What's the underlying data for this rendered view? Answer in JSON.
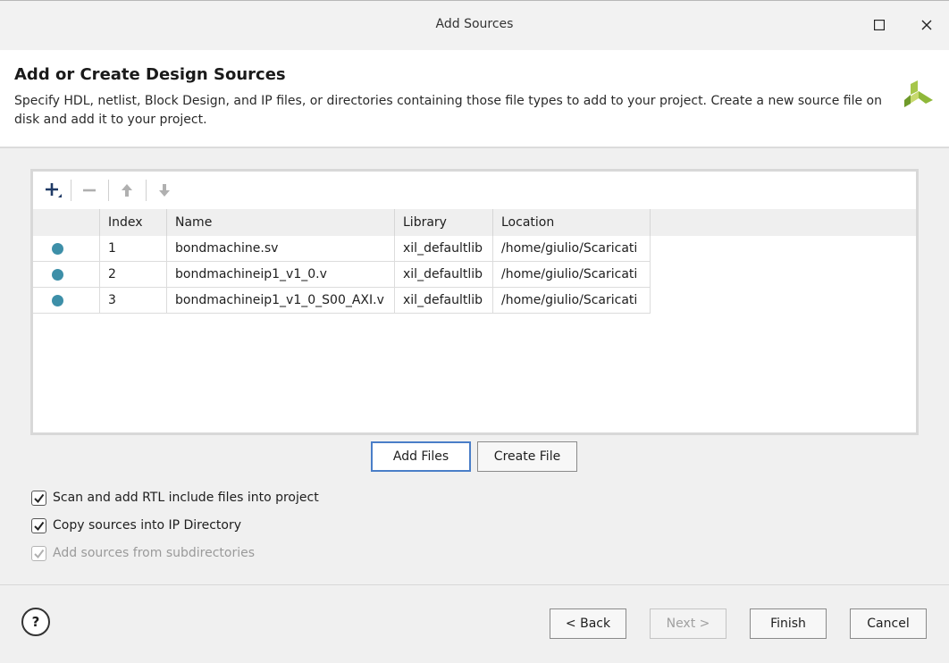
{
  "window": {
    "title": "Add Sources"
  },
  "header": {
    "title": "Add or Create Design Sources",
    "description": "Specify HDL, netlist, Block Design, and IP files, or directories containing those file types to add to your project. Create a new source file on disk and add it to your project."
  },
  "table": {
    "columns": [
      "",
      "Index",
      "Name",
      "Library",
      "Location"
    ],
    "rows": [
      {
        "index": "1",
        "name": "bondmachine.sv",
        "library": "xil_defaultlib",
        "location": "/home/giulio/Scaricati"
      },
      {
        "index": "2",
        "name": "bondmachineip1_v1_0.v",
        "library": "xil_defaultlib",
        "location": "/home/giulio/Scaricati"
      },
      {
        "index": "3",
        "name": "bondmachineip1_v1_0_S00_AXI.v",
        "library": "xil_defaultlib",
        "location": "/home/giulio/Scaricati"
      }
    ]
  },
  "actions": {
    "add_files": "Add Files",
    "create_file": "Create File"
  },
  "options": {
    "scan_rtl": "Scan and add RTL include files into project",
    "copy_sources": "Copy sources into IP Directory",
    "add_subdirs": "Add sources from subdirectories"
  },
  "footer": {
    "help": "?",
    "back": "< Back",
    "next": "Next >",
    "finish": "Finish",
    "cancel": "Cancel"
  },
  "colors": {
    "status_dot": "#3d8fa8",
    "primary_border": "#4a7ec8",
    "logo_green": "#8fb83a"
  }
}
